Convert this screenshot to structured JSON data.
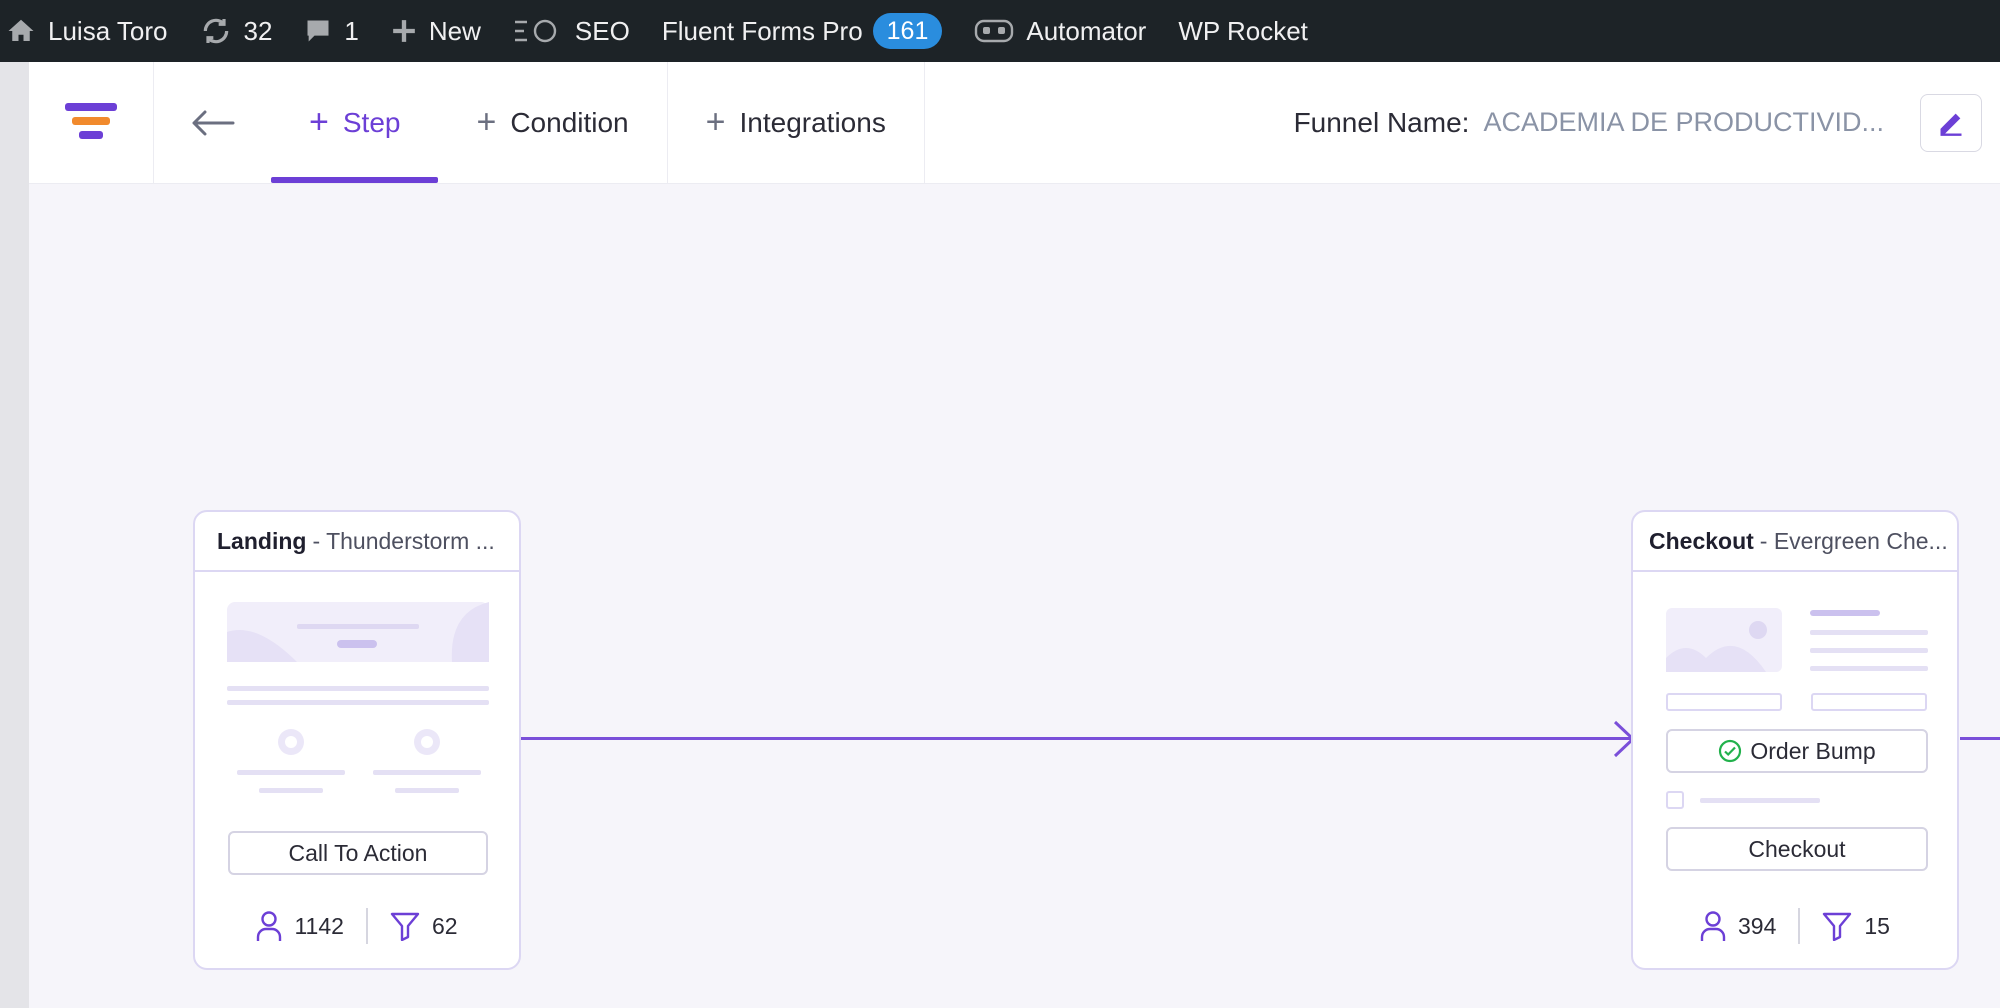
{
  "admin_bar": {
    "user": "Luisa Toro",
    "updates_count": "32",
    "comments_count": "1",
    "new_label": "New",
    "seo_label": "SEO",
    "fluent_forms_label": "Fluent Forms Pro",
    "fluent_forms_badge": "161",
    "automator_label": "Automator",
    "wp_rocket_label": "WP Rocket"
  },
  "funnel_header": {
    "tabs": [
      {
        "label": "Step",
        "active": true
      },
      {
        "label": "Condition",
        "active": false
      },
      {
        "label": "Integrations",
        "active": false
      }
    ],
    "funnel_name_label": "Funnel Name:",
    "funnel_name_value": "ACADEMIA DE PRODUCTIVID..."
  },
  "steps": [
    {
      "type": "Landing",
      "name": "- Thunderstorm ...",
      "button_label": "Call To Action",
      "visitors": "1142",
      "conversions": "62"
    },
    {
      "type": "Checkout",
      "name": "- Evergreen Che...",
      "order_bump_label": "Order Bump",
      "button_label": "Checkout",
      "visitors": "394",
      "conversions": "15"
    }
  ],
  "colors": {
    "accent": "#6c3fd6",
    "admin_bar": "#1d2327",
    "badge": "#2a8dde",
    "canvas": "#f6f5fa",
    "success": "#22b14c"
  }
}
